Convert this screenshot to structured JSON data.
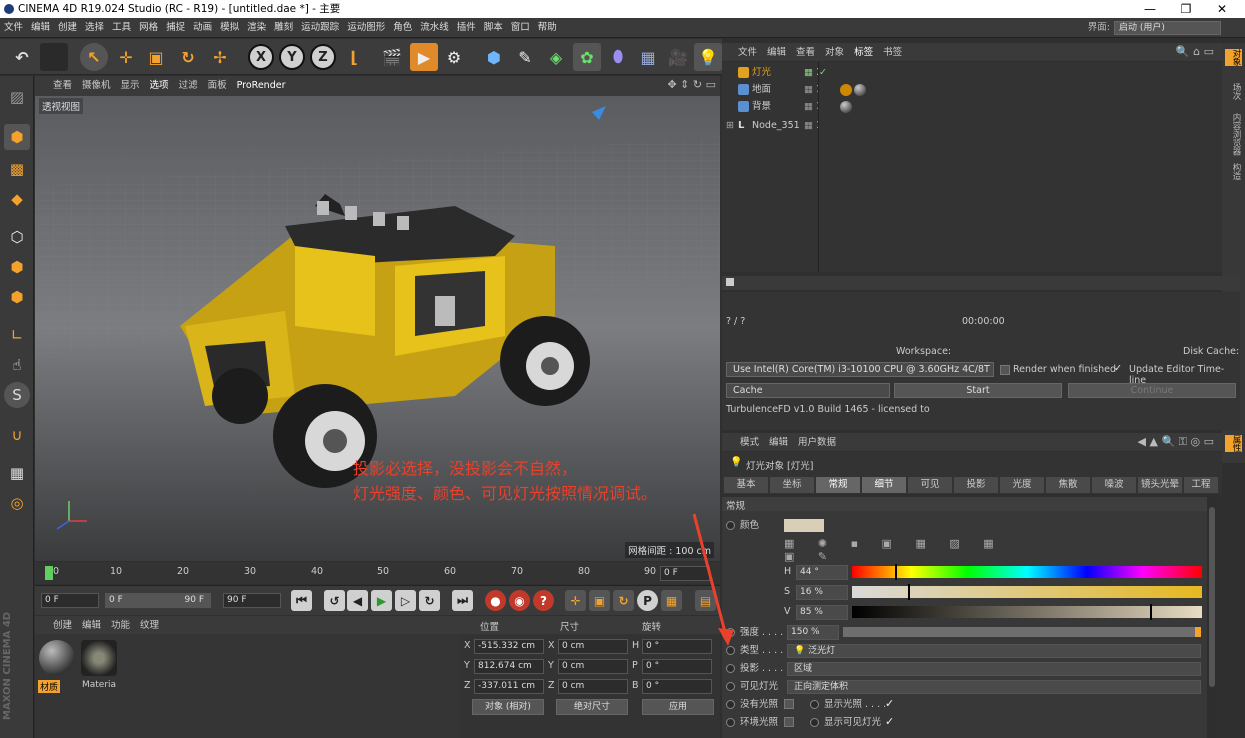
{
  "window": {
    "title": "CINEMA 4D R19.024 Studio (RC - R19) - [untitled.dae *] - 主要",
    "controls": [
      "—",
      "❐",
      "✕"
    ]
  },
  "menu": {
    "items": [
      "文件",
      "编辑",
      "创建",
      "选择",
      "工具",
      "网格",
      "捕捉",
      "动画",
      "模拟",
      "渲染",
      "雕刻",
      "运动跟踪",
      "运动图形",
      "角色",
      "流水线",
      "插件",
      "脚本",
      "窗口",
      "帮助"
    ],
    "layout_label": "界面:",
    "layout_value": "启动 (用户)"
  },
  "toolbar": {
    "axis_x": "X",
    "axis_y": "Y",
    "axis_z": "Z"
  },
  "viewport": {
    "menu": [
      "查看",
      "摄像机",
      "显示",
      "选项",
      "过滤",
      "面板",
      "ProRender"
    ],
    "label": "透视视图",
    "grid_distance": "网格间距 : 100 cm",
    "annotation_line1": "投影必选择，没投影会不自然，",
    "annotation_line2": "灯光强度、颜色、可见灯光按照情况调试。"
  },
  "timeline": {
    "ticks": [
      "0",
      "10",
      "20",
      "30",
      "40",
      "50",
      "60",
      "70",
      "80",
      "90"
    ],
    "current_frame": "0 F"
  },
  "playbar": {
    "start": "0 F",
    "preview_start": "0 F",
    "preview_end": "90 F",
    "end": "90 F"
  },
  "materials": {
    "menu": [
      "创建",
      "编辑",
      "功能",
      "纹理"
    ],
    "items": [
      {
        "name": "材质",
        "selected": true
      },
      {
        "name": "Materia",
        "selected": false
      }
    ]
  },
  "maxon_logo": "MAXON CINEMA 4D",
  "coordinates": {
    "headers": [
      "位置",
      "尺寸",
      "旋转"
    ],
    "rows": [
      {
        "axis": "X",
        "pos": "-515.332 cm",
        "size_axis": "X",
        "size": "0 cm",
        "rot_axis": "H",
        "rot": "0 °"
      },
      {
        "axis": "Y",
        "pos": "812.674 cm",
        "size_axis": "Y",
        "size": "0 cm",
        "rot_axis": "P",
        "rot": "0 °"
      },
      {
        "axis": "Z",
        "pos": "-337.011 cm",
        "size_axis": "Z",
        "size": "0 cm",
        "rot_axis": "B",
        "rot": "0 °"
      }
    ],
    "mode": "对象 (相对)",
    "size_mode": "绝对尺寸",
    "apply": "应用"
  },
  "object_manager": {
    "menu": [
      "文件",
      "编辑",
      "查看",
      "对象",
      "标签",
      "书签"
    ],
    "objects": [
      {
        "name": "灯光",
        "color": "#e0a020"
      },
      {
        "name": "地面",
        "color": "#5a8fd0"
      },
      {
        "name": "背景",
        "color": "#5a8fd0"
      },
      {
        "name": "Node_351",
        "color": "#dddddd"
      }
    ],
    "right_tabs": [
      "对象",
      "场次",
      "内容浏览器",
      "构造"
    ]
  },
  "render": {
    "progress": "? / ?",
    "time": "00:00:00",
    "workspace_label": "Workspace:",
    "disk_cache_label": "Disk Cache:",
    "device": "Use  Intel(R) Core(TM) i3-10100 CPU @ 3.60GHz 4C/8T",
    "render_when_finished": "Render when finished",
    "update_editor": "Update Editor Time-line",
    "cache": "Cache",
    "start": "Start",
    "continue": "Continue",
    "build": "TurbulenceFD v1.0 Build 1465 - licensed to"
  },
  "attributes": {
    "menu": [
      "模式",
      "编辑",
      "用户数据"
    ],
    "object_title": "灯光对象 [灯光]",
    "tabs": [
      "基本",
      "坐标",
      "常规",
      "细节",
      "可见",
      "投影",
      "光度",
      "焦散",
      "噪波",
      "镜头光晕",
      "工程"
    ],
    "active_tab": "常规",
    "section": "常规",
    "color_label": "颜色",
    "h_label": "H",
    "h_value": "44 °",
    "s_label": "S",
    "s_value": "16 %",
    "v_label": "V",
    "v_value": "85 %",
    "intensity_label": "强度 . . . .",
    "intensity_value": "150 %",
    "type_label": "类型 . . . .",
    "type_value": "泛光灯",
    "shadow_label": "投影 . . . .",
    "shadow_value": "区域",
    "visible_label": "可见灯光",
    "visible_value": "正向测定体积",
    "no_light_label": "没有光照",
    "show_light_label": "显示光照 . . . .",
    "ambient_label": "环境光照",
    "show_visible_label": "显示可见灯光",
    "right_tab": "属性",
    "hsv_h": 0.122,
    "hsv_s": 0.16,
    "hsv_v": 0.85,
    "intensity_fraction": 1.0
  },
  "colors": {
    "accent_orange": "#f3a32d",
    "annotation_red": "#e8412c",
    "vehicle_yellow": "#e6c21a"
  }
}
